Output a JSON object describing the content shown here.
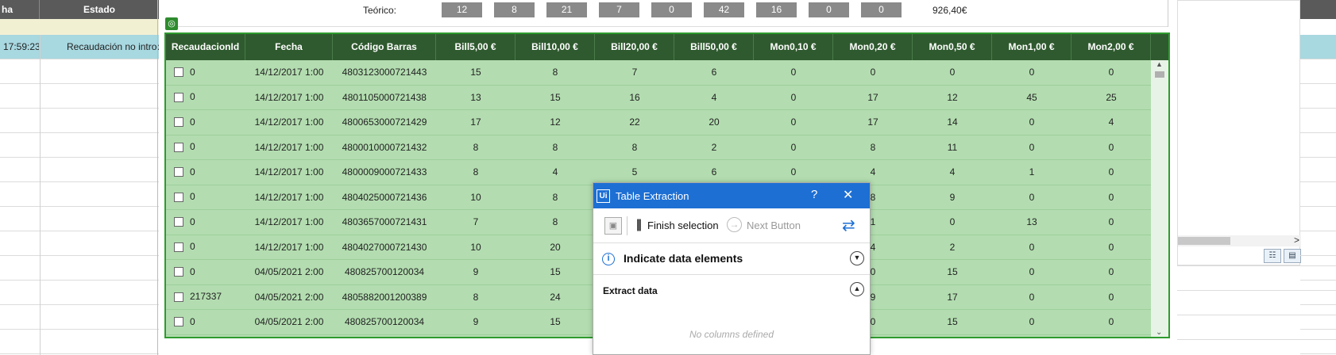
{
  "bg_left": {
    "header_col1": "ha",
    "header_col2": "Estado",
    "selected_time": "17:59:23",
    "selected_status": "Recaudación no introduc"
  },
  "teorico": {
    "label": "Teórico:",
    "values": [
      "12",
      "8",
      "21",
      "7",
      "0",
      "42",
      "16",
      "0",
      "0"
    ],
    "total": "926,40€"
  },
  "table": {
    "columns": [
      "RecaudacionId",
      "Fecha",
      "Código Barras",
      "Bill5,00 €",
      "Bill10,00 €",
      "Bill20,00 €",
      "Bill50,00 €",
      "Mon0,10 €",
      "Mon0,20 €",
      "Mon0,50 €",
      "Mon1,00 €",
      "Mon2,00 €"
    ],
    "rows": [
      [
        "0",
        "14/12/2017 1:00",
        "4803123000721443",
        "15",
        "8",
        "7",
        "6",
        "0",
        "0",
        "0",
        "0",
        "0"
      ],
      [
        "0",
        "14/12/2017 1:00",
        "4801105000721438",
        "13",
        "15",
        "16",
        "4",
        "0",
        "17",
        "12",
        "45",
        "25"
      ],
      [
        "0",
        "14/12/2017 1:00",
        "4800653000721429",
        "17",
        "12",
        "22",
        "20",
        "0",
        "17",
        "14",
        "0",
        "4"
      ],
      [
        "0",
        "14/12/2017 1:00",
        "4800010000721432",
        "8",
        "8",
        "8",
        "2",
        "0",
        "8",
        "11",
        "0",
        "0"
      ],
      [
        "0",
        "14/12/2017 1:00",
        "4800009000721433",
        "8",
        "4",
        "5",
        "6",
        "0",
        "4",
        "4",
        "1",
        "0"
      ],
      [
        "0",
        "14/12/2017 1:00",
        "4804025000721436",
        "10",
        "8",
        "",
        "",
        "",
        "8",
        "9",
        "0",
        "0"
      ],
      [
        "0",
        "14/12/2017 1:00",
        "4803657000721431",
        "7",
        "8",
        "",
        "",
        "",
        "1",
        "0",
        "13",
        "0"
      ],
      [
        "0",
        "14/12/2017 1:00",
        "4804027000721430",
        "10",
        "20",
        "",
        "",
        "",
        "4",
        "2",
        "0",
        "0"
      ],
      [
        "0",
        "04/05/2021 2:00",
        "480825700120034",
        "9",
        "15",
        "",
        "",
        "",
        "0",
        "15",
        "0",
        "0"
      ],
      [
        "217337",
        "04/05/2021 2:00",
        "4805882001200389",
        "8",
        "24",
        "",
        "",
        "",
        "9",
        "17",
        "0",
        "0"
      ],
      [
        "0",
        "04/05/2021 2:00",
        "480825700120034",
        "9",
        "15",
        "",
        "",
        "",
        "0",
        "15",
        "0",
        "0"
      ]
    ]
  },
  "dialog": {
    "title": "Table Extraction",
    "logo": "Ui",
    "help": "?",
    "close": "✕",
    "finish_label": "Finish selection",
    "next_label": "Next Button",
    "section1": "Indicate data elements",
    "section2": "Extract data",
    "empty_text": "No columns defined"
  },
  "colors": {
    "table_header": "#2f5a2f",
    "table_body": "#b3ddb0",
    "dialog_title": "#1d6fd4"
  },
  "icons": [
    "target-icon",
    "save-icon",
    "finish-icon",
    "next-icon",
    "refresh-icon",
    "info-icon",
    "chevron-down-icon",
    "chevron-up-icon",
    "close-icon",
    "help-icon"
  ]
}
